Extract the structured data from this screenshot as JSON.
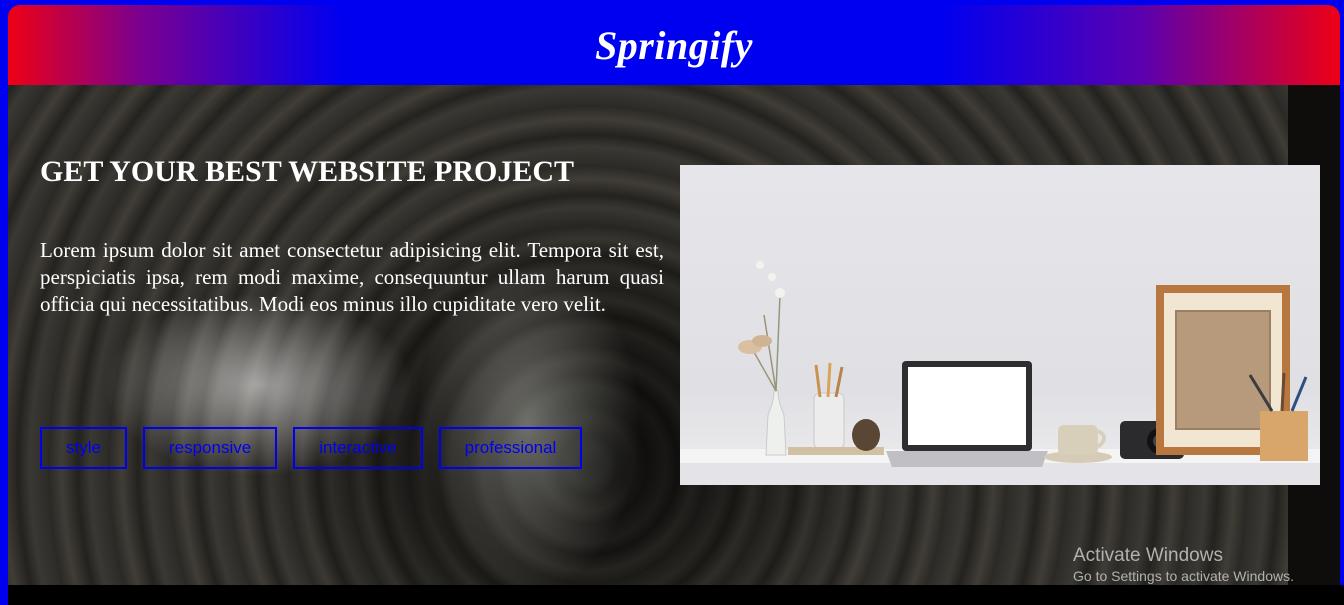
{
  "header": {
    "brand": "Springify"
  },
  "hero": {
    "headline": "GET YOUR BEST WEBSITE PROJECT",
    "description": "Lorem ipsum dolor sit amet consectetur adipisicing elit. Tempora sit est, perspiciatis ipsa, rem modi maxime, consequuntur ullam harum quasi officia qui necessitatibus. Modi eos minus illo cupiditate vero velit.",
    "tags": [
      "style",
      "responsive",
      "interactive",
      "professional"
    ]
  },
  "watermark": {
    "title": "Activate Windows",
    "subtitle": "Go to Settings to activate Windows."
  },
  "colors": {
    "frame": "#0000f0",
    "header_edge": "#ee0015",
    "tag": "#0000f0",
    "text": "#ffffff"
  }
}
